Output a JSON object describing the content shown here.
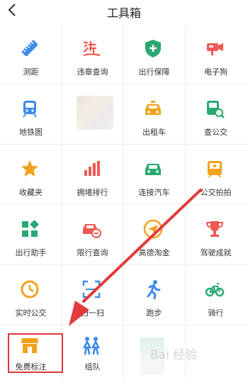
{
  "header": {
    "title": "工具箱"
  },
  "tools": [
    {
      "label": "测距",
      "icon": "ruler-icon",
      "color": "#3d8ce8"
    },
    {
      "label": "违章查询",
      "icon": "violation-icon",
      "color": "#ee5a52"
    },
    {
      "label": "出行保障",
      "icon": "shield-plus-icon",
      "color": "#2aa872"
    },
    {
      "label": "电子狗",
      "icon": "camera-icon",
      "color": "#ee5a52"
    },
    {
      "label": "地铁图",
      "icon": "subway-icon",
      "color": "#3d8ce8"
    },
    {
      "label": "",
      "icon": "blurred-icon",
      "color": "#e8e0d8"
    },
    {
      "label": "出租车",
      "icon": "taxi-icon",
      "color": "#f0a21b"
    },
    {
      "label": "查公交",
      "icon": "bus-search-icon",
      "color": "#2aa872"
    },
    {
      "label": "收藏夹",
      "icon": "star-icon",
      "color": "#f0a21b"
    },
    {
      "label": "拥堵排行",
      "icon": "bar-chart-icon",
      "color": "#ee5a52"
    },
    {
      "label": "连接汽车",
      "icon": "car-icon",
      "color": "#2aa872"
    },
    {
      "label": "公交拍拍",
      "icon": "bus-camera-icon",
      "color": "#f0a21b"
    },
    {
      "label": "出行助手",
      "icon": "grid-add-icon",
      "color": "#2aa872"
    },
    {
      "label": "限行查询",
      "icon": "car-limit-icon",
      "color": "#ee5a52"
    },
    {
      "label": "高德淘金",
      "icon": "paper-plane-icon",
      "color": "#f0a21b"
    },
    {
      "label": "驾驶成就",
      "icon": "trophy-icon",
      "color": "#ee5a52"
    },
    {
      "label": "实时公交",
      "icon": "clock-icon",
      "color": "#f0a21b"
    },
    {
      "label": "扫一扫",
      "icon": "scan-icon",
      "color": "#3d8ce8"
    },
    {
      "label": "跑步",
      "icon": "running-icon",
      "color": "#3d8ce8"
    },
    {
      "label": "骑行",
      "icon": "bicycle-icon",
      "color": "#2aa872"
    },
    {
      "label": "免费标注",
      "icon": "shop-icon",
      "color": "#f0a21b"
    },
    {
      "label": "组队",
      "icon": "team-icon",
      "color": "#3d8ce8"
    }
  ],
  "watermark": {
    "text": "Bai 经验"
  }
}
